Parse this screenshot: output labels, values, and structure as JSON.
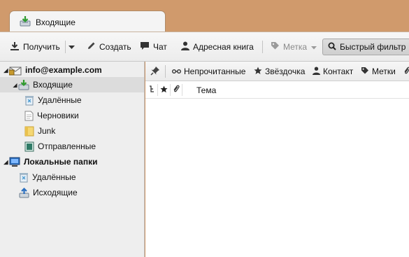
{
  "tab": {
    "title": "Входящие",
    "icon": "inbox-download-icon"
  },
  "toolbar": {
    "get_label": "Получить",
    "write_label": "Создать",
    "chat_label": "Чат",
    "addressbook_label": "Адресная книга",
    "tag_label": "Метка",
    "quickfilter_label": "Быстрый фильтр"
  },
  "sidebar": {
    "account": "info@example.com",
    "folders": [
      {
        "label": "Входящие",
        "icon": "inbox-icon"
      },
      {
        "label": "Удалённые",
        "icon": "trash-icon"
      },
      {
        "label": "Черновики",
        "icon": "drafts-icon"
      },
      {
        "label": "Junk",
        "icon": "junk-folder-icon"
      },
      {
        "label": "Отправленные",
        "icon": "sent-icon"
      }
    ],
    "local_folders": "Локальные папки",
    "local_items": [
      {
        "label": "Удалённые",
        "icon": "trash-icon"
      },
      {
        "label": "Исходящие",
        "icon": "outbox-icon"
      }
    ]
  },
  "filterbar": {
    "unread": "Непрочитанные",
    "starred": "Звёздочка",
    "contact": "Контакт",
    "tags": "Метки"
  },
  "columns": {
    "subject": "Тема"
  },
  "colors": {
    "titlebar": "#d09a6c",
    "sidebar_bg": "#eeeeee",
    "selected_row": "#dcdcdc"
  }
}
